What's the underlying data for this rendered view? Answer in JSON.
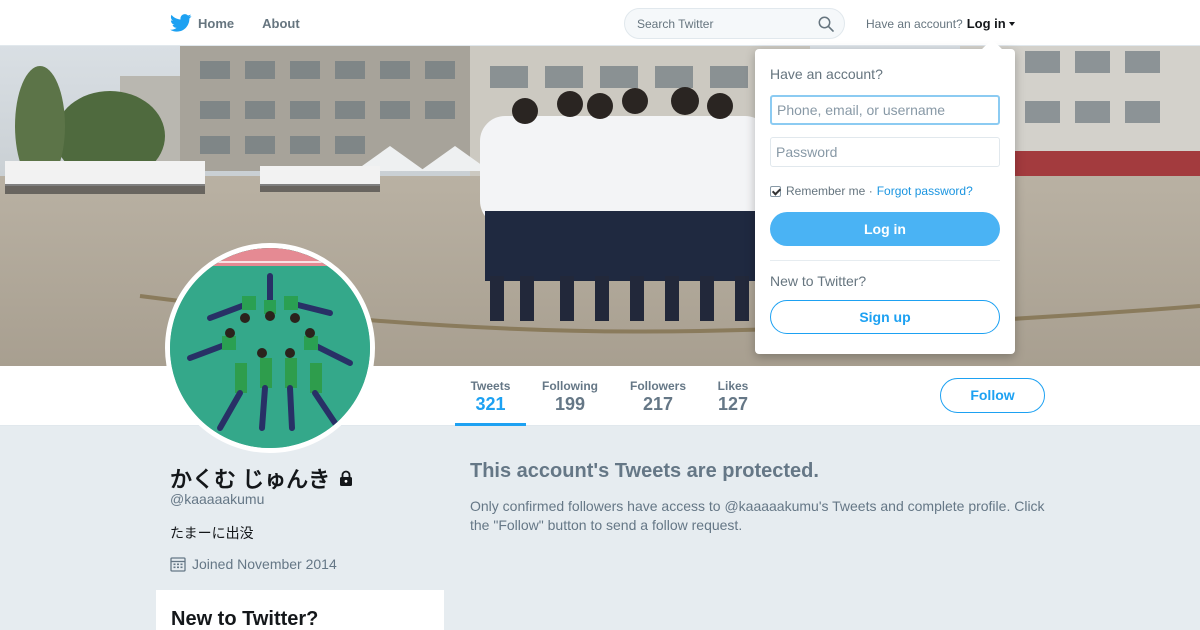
{
  "nav": {
    "home": "Home",
    "about": "About",
    "search_placeholder": "Search Twitter",
    "have_account": "Have an account?",
    "login": "Log in"
  },
  "profile": {
    "name": "かくむ じゅんき",
    "handle": "@kaaaaakumu",
    "bio": "たまーに出没",
    "joined": "Joined November 2014"
  },
  "stats": [
    {
      "label": "Tweets",
      "value": "321"
    },
    {
      "label": "Following",
      "value": "199"
    },
    {
      "label": "Followers",
      "value": "217"
    },
    {
      "label": "Likes",
      "value": "127"
    }
  ],
  "follow_label": "Follow",
  "protected": {
    "title": "This account's Tweets are protected.",
    "text": "Only confirmed followers have access to @kaaaaakumu's Tweets and complete profile. Click the \"Follow\" button to send a follow request."
  },
  "sidebar": {
    "new_title": "New to Twitter?"
  },
  "login_dropdown": {
    "title": "Have an account?",
    "username_placeholder": "Phone, email, or username",
    "password_placeholder": "Password",
    "remember": "Remember me",
    "forgot": "Forgot password?",
    "login_button": "Log in",
    "new_text": "New to Twitter?",
    "signup_button": "Sign up"
  },
  "colors": {
    "accent": "#1da1f2",
    "login_button": "#4ab3f4",
    "background": "#e6ecf0"
  }
}
